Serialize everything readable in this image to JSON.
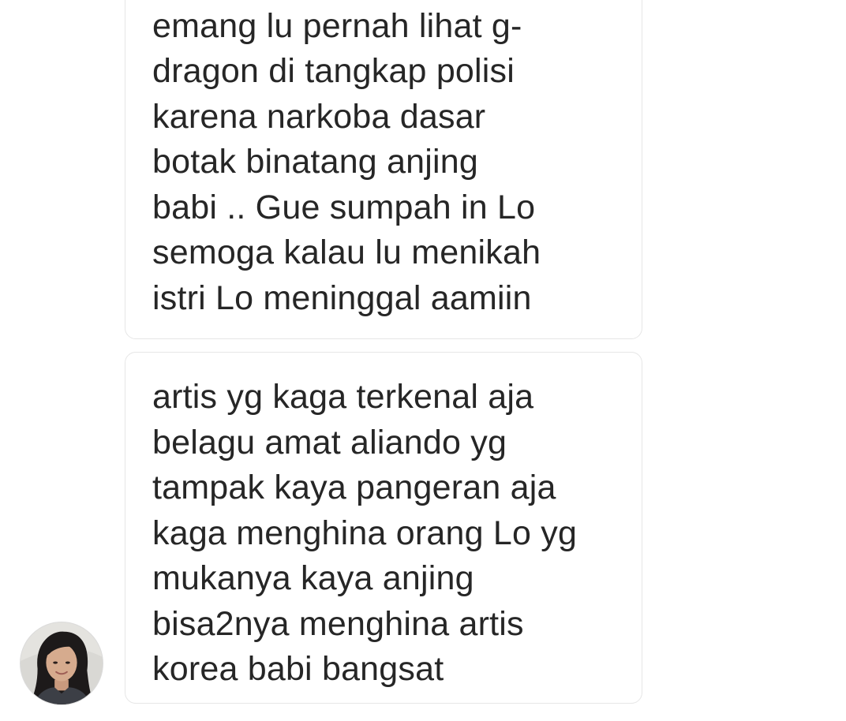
{
  "conversation": {
    "messages": [
      {
        "text": "emang lu pernah lihat g-\ndragon di tangkap polisi\nkarena narkoba dasar\nbotak binatang anjing\nbabi .. Gue sumpah in Lo\nsemoga kalau lu menikah\nistri Lo meninggal aamiin"
      },
      {
        "text": "artis yg kaga terkenal aja\nbelagu amat aliando yg\ntampak kaya pangeran aja\nkaga menghina orang Lo yg\nmukanya kaya anjing\nbisa2nya menghina artis\nkorea babi bangsat"
      }
    ],
    "sender": {
      "avatar_icon": "user-avatar-photo"
    }
  },
  "colors": {
    "background": "#ffffff",
    "bubble_border": "#e6e6e6",
    "text": "#262626"
  }
}
